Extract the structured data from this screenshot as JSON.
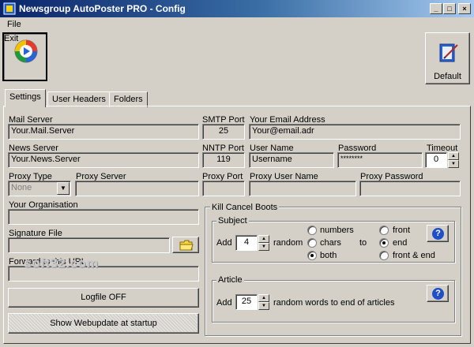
{
  "window": {
    "title": "Newsgroup AutoPoster PRO - Config",
    "controls": {
      "minimize": "_",
      "maximize": "□",
      "close": "×"
    }
  },
  "menu": {
    "file": "File"
  },
  "toolbar": {
    "exit_label": "Exit",
    "default_label": "Default"
  },
  "tabs": [
    {
      "label": "Settings",
      "active": true
    },
    {
      "label": "User Headers",
      "active": false
    },
    {
      "label": "Folders",
      "active": false
    }
  ],
  "settings": {
    "mail_server": {
      "label": "Mail Server",
      "value": "Your.Mail.Server"
    },
    "smtp_port": {
      "label": "SMTP Port",
      "value": "25"
    },
    "email": {
      "label": "Your Email Address",
      "value": "Your@email.adr"
    },
    "news_server": {
      "label": "News Server",
      "value": "Your.News.Server"
    },
    "nntp_port": {
      "label": "NNTP Port",
      "value": "119"
    },
    "user_name": {
      "label": "User Name",
      "value": "Username"
    },
    "password": {
      "label": "Password",
      "value": "********"
    },
    "timeout": {
      "label": "Timeout",
      "value": "0"
    },
    "proxy_type": {
      "label": "Proxy Type",
      "value": "None"
    },
    "proxy_server": {
      "label": "Proxy Server",
      "value": ""
    },
    "proxy_port": {
      "label": "Proxy Port",
      "value": ""
    },
    "proxy_user": {
      "label": "Proxy User Name",
      "value": ""
    },
    "proxy_password": {
      "label": "Proxy Password",
      "value": ""
    },
    "organisation": {
      "label": "Your Organisation",
      "value": ""
    },
    "signature_file": {
      "label": "Signature File",
      "value": ""
    },
    "url": {
      "label": "Forward to this URL",
      "value": ""
    },
    "logfile_button": "Logfile OFF",
    "webupdate_button": "Show Webupdate at startup"
  },
  "kill_cancel": {
    "title": "Kill Cancel Boots",
    "subject": {
      "title": "Subject",
      "add_label": "Add",
      "count": "4",
      "random_label": "random",
      "to_label": "to",
      "type_options": [
        {
          "label": "numbers",
          "selected": false
        },
        {
          "label": "chars",
          "selected": false
        },
        {
          "label": "both",
          "selected": true
        }
      ],
      "position_options": [
        {
          "label": "front",
          "selected": false
        },
        {
          "label": "end",
          "selected": true
        },
        {
          "label": "front & end",
          "selected": false
        }
      ],
      "help": "?"
    },
    "article": {
      "title": "Article",
      "add_label": "Add",
      "count": "25",
      "suffix": "random words to end of articles",
      "help": "?"
    }
  },
  "watermark": "soft32.com",
  "colors": {
    "title_start": "#0a246a",
    "title_end": "#a6caf0",
    "face": "#d4d0c8",
    "help_icon": "#1f4fc8"
  }
}
